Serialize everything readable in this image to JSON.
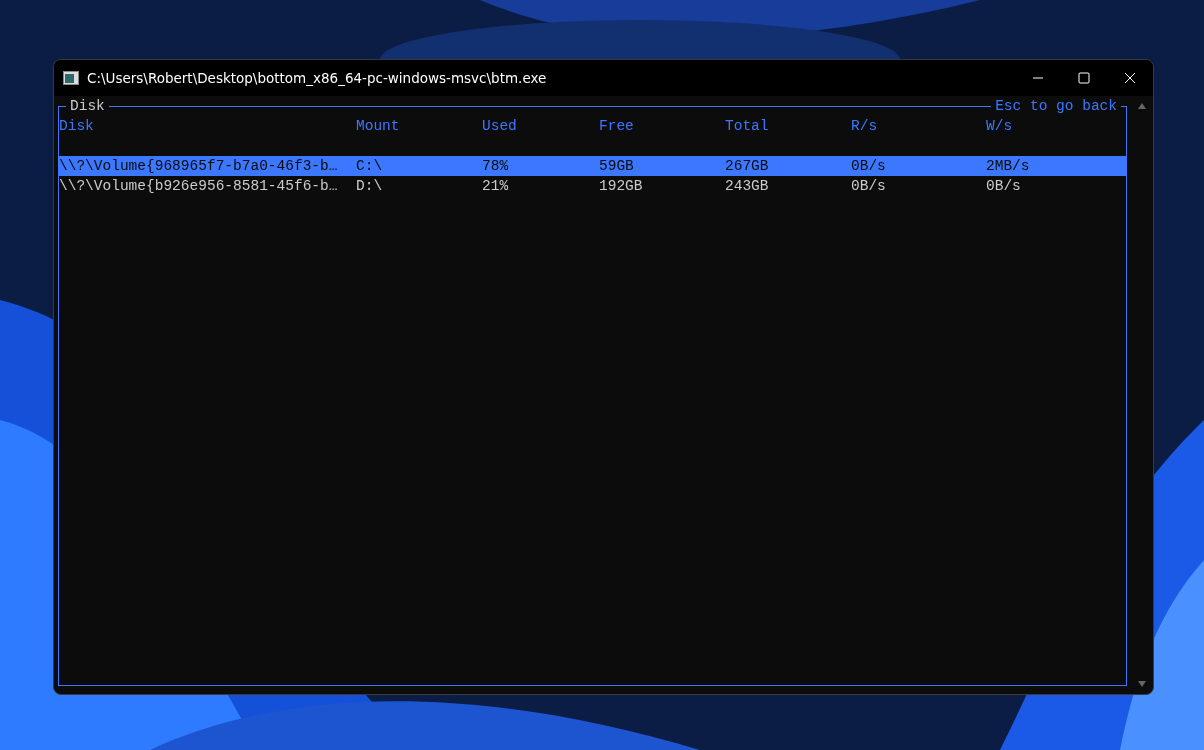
{
  "window": {
    "title": "C:\\Users\\Robert\\Desktop\\bottom_x86_64-pc-windows-msvc\\btm.exe"
  },
  "panel": {
    "title": "Disk",
    "hint": "Esc to go back"
  },
  "table": {
    "columns": [
      "Disk",
      "Mount",
      "Used",
      "Free",
      "Total",
      "R/s",
      "W/s"
    ],
    "rows": [
      {
        "cells": [
          "\\\\?\\Volume{968965f7-b7a0-46f3-b…",
          "C:\\",
          "78%",
          "59GB",
          "267GB",
          "0B/s",
          "2MB/s"
        ],
        "selected": true
      },
      {
        "cells": [
          "\\\\?\\Volume{b926e956-8581-45f6-b…",
          "D:\\",
          "21%",
          "192GB",
          "243GB",
          "0B/s",
          "0B/s"
        ],
        "selected": false
      }
    ]
  }
}
